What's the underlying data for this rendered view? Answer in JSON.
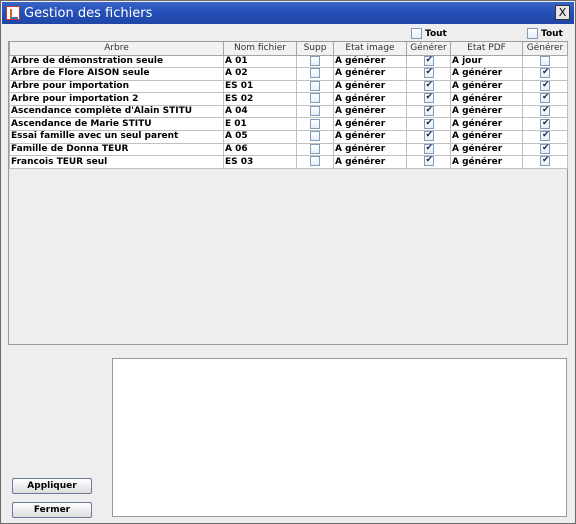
{
  "window": {
    "title": "Gestion des fichiers",
    "close_label": "X"
  },
  "tout_image": {
    "label": "Tout",
    "checked": false
  },
  "tout_pdf": {
    "label": "Tout",
    "checked": false
  },
  "table": {
    "headers": [
      "Arbre",
      "Nom fichier",
      "Supp",
      "Etat image",
      "Générer",
      "Etat PDF",
      "Générer"
    ],
    "rows": [
      {
        "arbre": "Arbre de démonstration seule",
        "fichier": "A 01",
        "supp": false,
        "etat_image": "A générer",
        "gen_image": true,
        "etat_pdf": "A jour",
        "gen_pdf": false
      },
      {
        "arbre": "Arbre de Flore AISON seule",
        "fichier": "A 02",
        "supp": false,
        "etat_image": "A générer",
        "gen_image": true,
        "etat_pdf": "A générer",
        "gen_pdf": true
      },
      {
        "arbre": "Arbre pour importation",
        "fichier": "ES 01",
        "supp": false,
        "etat_image": "A générer",
        "gen_image": true,
        "etat_pdf": "A générer",
        "gen_pdf": true
      },
      {
        "arbre": "Arbre pour importation 2",
        "fichier": "ES 02",
        "supp": false,
        "etat_image": "A générer",
        "gen_image": true,
        "etat_pdf": "A générer",
        "gen_pdf": true
      },
      {
        "arbre": "Ascendance complète d'Alain STITU",
        "fichier": "A 04",
        "supp": false,
        "etat_image": "A générer",
        "gen_image": true,
        "etat_pdf": "A générer",
        "gen_pdf": true
      },
      {
        "arbre": "Ascendance de Marie STITU",
        "fichier": "E 01",
        "supp": false,
        "etat_image": "A générer",
        "gen_image": true,
        "etat_pdf": "A générer",
        "gen_pdf": true
      },
      {
        "arbre": "Essai famille avec un seul parent",
        "fichier": "A 05",
        "supp": false,
        "etat_image": "A générer",
        "gen_image": true,
        "etat_pdf": "A générer",
        "gen_pdf": true
      },
      {
        "arbre": "Famille de Donna TEUR",
        "fichier": "A 06",
        "supp": false,
        "etat_image": "A générer",
        "gen_image": true,
        "etat_pdf": "A générer",
        "gen_pdf": true
      },
      {
        "arbre": "Francois TEUR seul",
        "fichier": "ES 03",
        "supp": false,
        "etat_image": "A générer",
        "gen_image": true,
        "etat_pdf": "A générer",
        "gen_pdf": true
      }
    ]
  },
  "buttons": {
    "apply": "Appliquer",
    "close": "Fermer"
  }
}
